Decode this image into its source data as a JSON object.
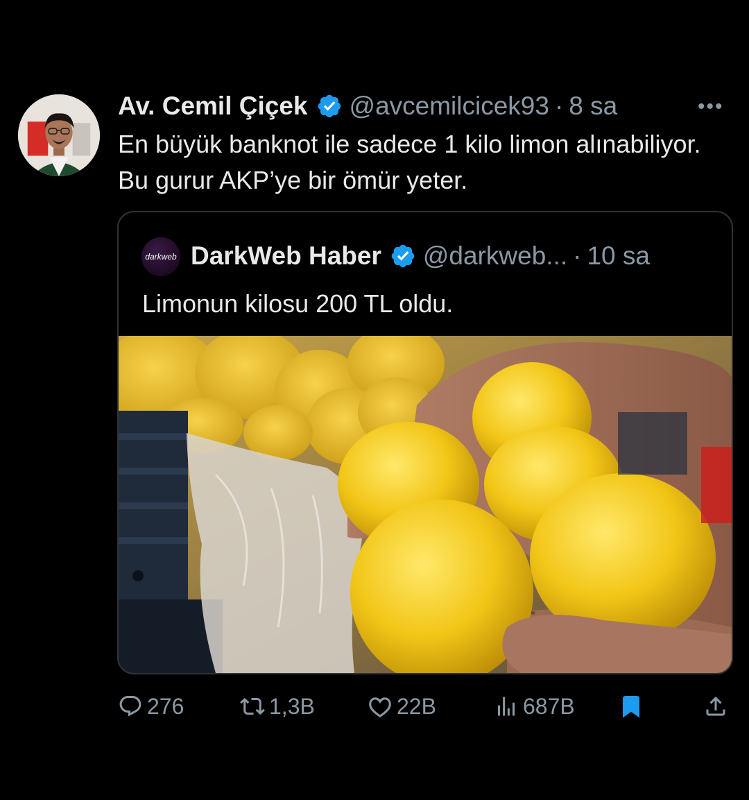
{
  "tweet": {
    "author_name": "Av. Cemil Çiçek",
    "author_handle": "@avcemilcicek93",
    "separator": "·",
    "time": "8 sa",
    "more_icon": "more-icon",
    "text": "En büyük banknot ile sadece 1 kilo limon alınabiliyor. Bu gurur AKP’ye bir ömür yeter."
  },
  "quoted": {
    "avatar_text": "darkweb",
    "author_name": "DarkWeb Haber",
    "author_handle": "@darkweb...",
    "separator": "·",
    "time": "10 sa",
    "text": "Limonun kilosu 200 TL oldu."
  },
  "actions": {
    "replies": "276",
    "retweets": "1,3B",
    "likes": "22B",
    "views": "687B"
  },
  "colors": {
    "background": "#000000",
    "text_primary": "#e7e9ea",
    "text_secondary": "#8b98a5",
    "verified": "#1d9bf0",
    "bookmark_active": "#1d9bf0",
    "border": "#2f3336"
  },
  "icons": [
    "verified-badge-icon",
    "reply-icon",
    "retweet-icon",
    "like-icon",
    "views-icon",
    "bookmark-icon",
    "share-icon"
  ]
}
